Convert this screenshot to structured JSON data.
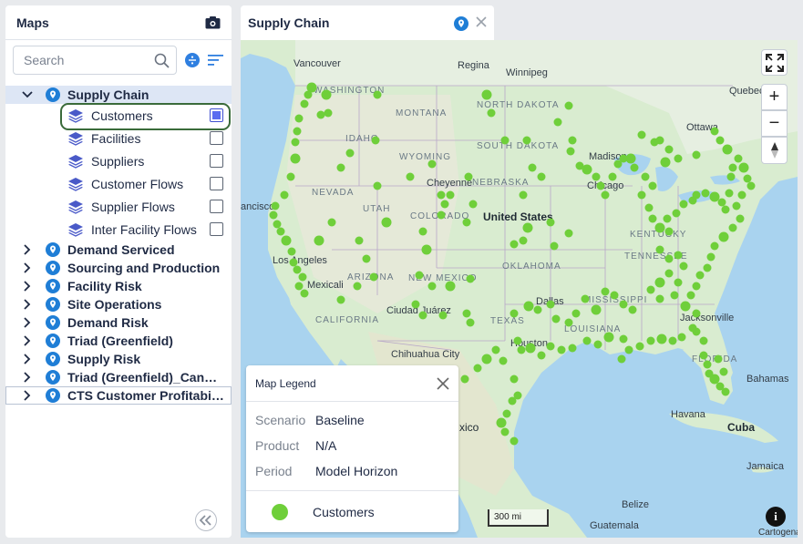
{
  "maps_panel": {
    "title": "Maps",
    "search_placeholder": "Search",
    "tree": [
      {
        "label": "Supply Chain",
        "expanded": true,
        "selected": true
      },
      {
        "label": "Demand Serviced"
      },
      {
        "label": "Sourcing and Production"
      },
      {
        "label": "Facility Risk"
      },
      {
        "label": "Site Operations"
      },
      {
        "label": "Demand Risk"
      },
      {
        "label": "Triad (Greenfield)"
      },
      {
        "label": "Supply Risk"
      },
      {
        "label": "Triad (Greenfield)_Candid..."
      },
      {
        "label": "CTS Customer Profitability"
      }
    ],
    "layers": [
      {
        "label": "Customers",
        "checked": true
      },
      {
        "label": "Facilities",
        "checked": false
      },
      {
        "label": "Suppliers",
        "checked": false
      },
      {
        "label": "Customer Flows",
        "checked": false
      },
      {
        "label": "Supplier Flows",
        "checked": false
      },
      {
        "label": "Inter Facility Flows",
        "checked": false
      }
    ]
  },
  "map_tab": {
    "title": "Supply Chain"
  },
  "map": {
    "labels": {
      "vancouver": "Vancouver",
      "regina": "Regina",
      "winnipeg": "Winnipeg",
      "quebec": "Quebec",
      "ottawa": "Ottawa",
      "washington": "WASHINGTON",
      "montana": "MONTANA",
      "north_dakota": "NORTH DAKOTA",
      "south_dakota": "SOUTH DAKOTA",
      "idaho": "IDAHO",
      "wyoming": "WYOMING",
      "nevada": "NEVADA",
      "utah": "UTAH",
      "colorado": "COLORADO",
      "nebraska": "NEBRASKA",
      "cheyenne": "Cheyenne",
      "madison": "Madison",
      "chicago": "Chicago",
      "united_states": "United States",
      "kentucky": "KENTUCKY",
      "tennessee": "TENNESSEE",
      "los_angeles": "Los Angeles",
      "mexicali": "Mexicali",
      "arizona": "ARIZONA",
      "new_mexico": "NEW MEXICO",
      "oklahoma": "OKLAHOMA",
      "dallas": "Dallas",
      "mississippi": "MISSISSIPPI",
      "california": "CALIFORNIA",
      "ciudad_juarez": "Ciudad Juárez",
      "texas": "TEXAS",
      "louisiana": "LOUISIANA",
      "houston": "Houston",
      "jacksonville": "Jacksonville",
      "chihuahua": "Chihuahua City",
      "florida": "FLORIDA",
      "bahamas": "Bahamas",
      "havana": "Havana",
      "cuba": "Cuba",
      "mexico": "xico",
      "jamaica": "Jamaica",
      "belize": "Belize",
      "guatemala": "Guatemala",
      "sf": "ancisco"
    },
    "scale_label": "300 mi",
    "attribution": "Cartogena",
    "zoom_in": "+",
    "zoom_out": "−",
    "info": "i"
  },
  "legend": {
    "title": "Map Legend",
    "rows": [
      {
        "key": "Scenario",
        "value": "Baseline"
      },
      {
        "key": "Product",
        "value": "N/A"
      },
      {
        "key": "Period",
        "value": "Model Horizon"
      }
    ],
    "item_label": "Customers",
    "item_color": "#6fcf3a"
  },
  "colors": {
    "accent": "#1f7ed6",
    "selected_row": "#dde6f5",
    "customer_dot": "#6fcf3a",
    "highlight_ring": "#3a6b3a"
  }
}
